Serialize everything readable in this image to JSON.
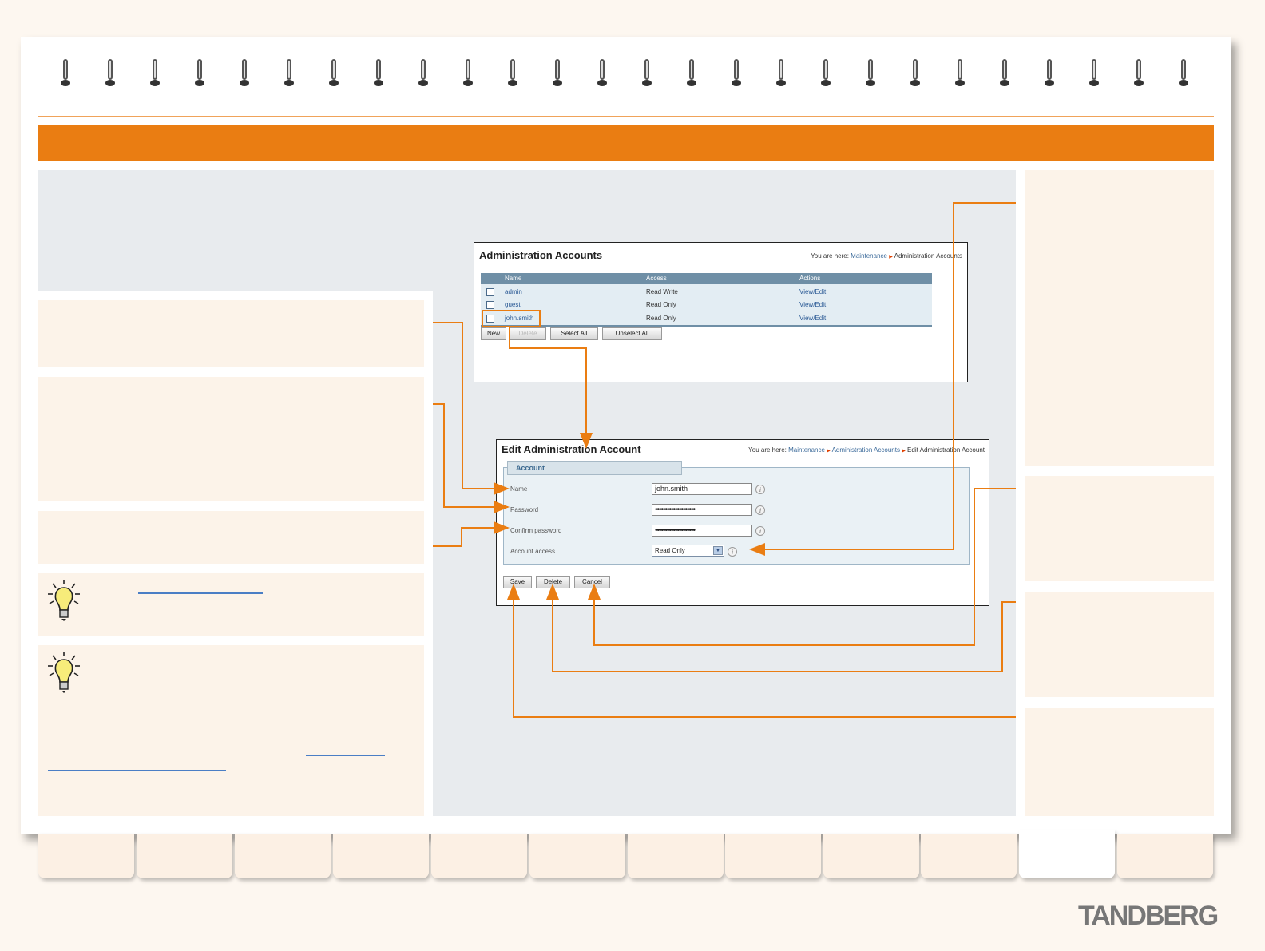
{
  "colors": {
    "accent": "#ea7d12",
    "panel": "#fcf3e9",
    "gray_area": "#e8ebee",
    "link": "#4a7ec5"
  },
  "shot1": {
    "title": "Administration Accounts",
    "breadcrumb": {
      "prefix": "You are here:",
      "items": [
        "Maintenance",
        "Administration Accounts"
      ]
    },
    "columns": [
      "Name",
      "Access",
      "Actions"
    ],
    "rows": [
      {
        "name": "admin",
        "access": "Read Write",
        "action": "View/Edit"
      },
      {
        "name": "guest",
        "access": "Read Only",
        "action": "View/Edit"
      },
      {
        "name": "john.smith",
        "access": "Read Only",
        "action": "View/Edit"
      }
    ],
    "buttons": {
      "new": "New",
      "delete": "Delete",
      "select_all": "Select All",
      "unselect_all": "Unselect All"
    }
  },
  "shot2": {
    "title": "Edit Administration Account",
    "breadcrumb": {
      "prefix": "You are here:",
      "items": [
        "Maintenance",
        "Administration Accounts",
        "Edit Administration Account"
      ]
    },
    "section": "Account",
    "fields": {
      "name_label": "Name",
      "name_value": "john.smith",
      "password_label": "Password",
      "password_value": "••••••••••••••••••••",
      "confirm_label": "Confirm password",
      "confirm_value": "••••••••••••••••••••",
      "access_label": "Account access",
      "access_value": "Read Only"
    },
    "info_glyph": "i",
    "buttons": {
      "save": "Save",
      "delete": "Delete",
      "cancel": "Cancel"
    }
  },
  "icons": {
    "tip": "lightbulb-icon",
    "select_arrow": "chevron-down-icon"
  },
  "logo": "TANDBERG"
}
